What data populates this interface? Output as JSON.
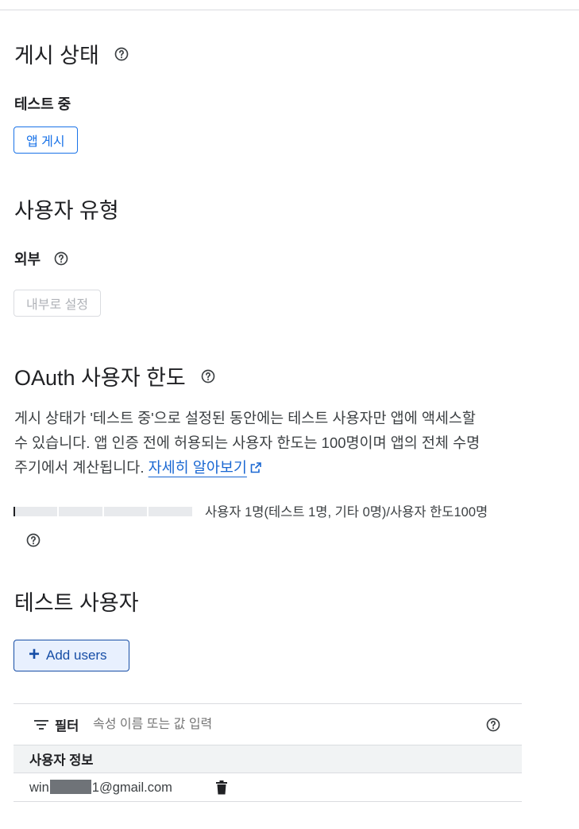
{
  "publish_status": {
    "heading": "게시 상태",
    "status_label": "테스트 중",
    "publish_button": "앱 게시"
  },
  "user_type": {
    "heading": "사용자 유형",
    "type_label": "외부",
    "set_internal_button": "내부로 설정"
  },
  "oauth_limit": {
    "heading": "OAuth 사용자 한도",
    "description_line1": "게시 상태가 '테스트 중'으로 설정된 동안에는 테스트 사용자만 앱에 액세스할",
    "description_line2": "수 있습니다. 앱 인증 전에 허용되는 사용자 한도는 100명이며 앱의 전체 수명",
    "description_line3": "주기에서 계산됩니다.",
    "learn_more_link": "자세히 알아보기",
    "progress_fraction": 0.01,
    "quota_text": "사용자 1명(테스트 1명, 기타 0명)/사용자 한도100명"
  },
  "test_users": {
    "heading": "테스트 사용자",
    "add_button": "Add users",
    "filter_label": "필터",
    "filter_placeholder": "속성 이름 또는 값 입력",
    "column_header": "사용자 정보",
    "rows": [
      {
        "email_prefix": "win",
        "email_suffix": "1@gmail.com"
      }
    ]
  },
  "icons": {
    "help": "help-circle-icon",
    "external": "open-in-new-icon",
    "filter": "filter-list-icon",
    "delete": "trash-icon",
    "add": "plus-icon"
  },
  "colors": {
    "accent": "#1a73e8",
    "link": "#1967d2",
    "add_button_bg": "#e8f0fe",
    "add_button_fg": "#174ea6"
  }
}
